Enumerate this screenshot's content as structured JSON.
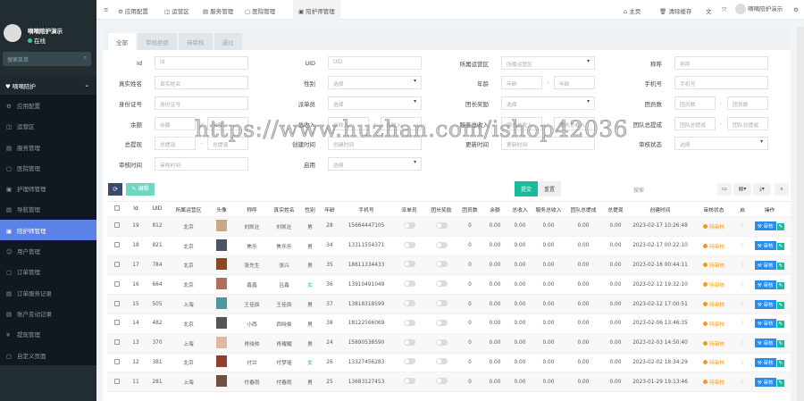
{
  "sidebar": {
    "user_name": "嘀嘀陪护演示",
    "status": "在线",
    "search_placeholder": "搜索菜单",
    "group": "嘀嘀陪护",
    "items": [
      {
        "label": "应用配置",
        "icon": "gear-icon",
        "glyph": "⚙"
      },
      {
        "label": "运营区",
        "icon": "map-icon",
        "glyph": "◫"
      },
      {
        "label": "服务管理",
        "icon": "list-icon",
        "glyph": "▤"
      },
      {
        "label": "医院管理",
        "icon": "hospital-icon",
        "glyph": "▢"
      },
      {
        "label": "护理师管理",
        "icon": "card-icon",
        "glyph": "▣"
      },
      {
        "label": "导航管理",
        "icon": "nav-icon",
        "glyph": "▤"
      },
      {
        "label": "陪护师管理",
        "icon": "id-card-icon",
        "glyph": "▣",
        "active": true
      },
      {
        "label": "用户管理",
        "icon": "user-icon",
        "glyph": "☺"
      },
      {
        "label": "订单管理",
        "icon": "order-icon",
        "glyph": "▢"
      },
      {
        "label": "订单服务记录",
        "icon": "record-icon",
        "glyph": "▤"
      },
      {
        "label": "账户变动记录",
        "icon": "account-icon",
        "glyph": "▤"
      },
      {
        "label": "提现管理",
        "icon": "yen-icon",
        "glyph": "¥"
      },
      {
        "label": "自定义页面",
        "icon": "page-icon",
        "glyph": "▢"
      }
    ]
  },
  "topbar": {
    "nav": [
      {
        "label": "应用配置",
        "glyph": "⚙"
      },
      {
        "label": "运营区",
        "glyph": "◫"
      },
      {
        "label": "服务管理",
        "glyph": "▤"
      },
      {
        "label": "医院管理",
        "glyph": "▢"
      },
      {
        "label": "陪护师管理",
        "glyph": "▣",
        "active": true
      }
    ],
    "home": "主页",
    "clear_cache": "清除缓存",
    "user": "嘀嘀陪护演示"
  },
  "tabs": [
    "全部",
    "审核拒绝",
    "待审核",
    "通过"
  ],
  "form": {
    "rows": [
      [
        {
          "label": "Id",
          "type": "text",
          "ph": "Id"
        },
        {
          "label": "UID",
          "type": "text",
          "ph": "UID"
        },
        {
          "label": "所属运营区",
          "type": "select",
          "ph": "所属运营区"
        },
        {
          "label": "称呼",
          "type": "text",
          "ph": "称呼"
        }
      ],
      [
        {
          "label": "真实姓名",
          "type": "text",
          "ph": "真实姓名"
        },
        {
          "label": "性别",
          "type": "select",
          "ph": "选择"
        },
        {
          "label": "年龄",
          "type": "range",
          "ph": "年龄"
        },
        {
          "label": "手机号",
          "type": "text",
          "ph": "手机号"
        }
      ],
      [
        {
          "label": "身份证号",
          "type": "text",
          "ph": "身份证号"
        },
        {
          "label": "派单员",
          "type": "select",
          "ph": "选择"
        },
        {
          "label": "团长奖励",
          "type": "select",
          "ph": "选择"
        },
        {
          "label": "团员数",
          "type": "range",
          "ph": "团员数"
        }
      ],
      [
        {
          "label": "余额",
          "type": "range",
          "ph": "余额"
        },
        {
          "label": "总收入",
          "type": "range",
          "ph": "总收入"
        },
        {
          "label": "服务总收入",
          "type": "range",
          "ph": "服务总收入"
        },
        {
          "label": "团队总提成",
          "type": "range",
          "ph": "团队总提成"
        }
      ],
      [
        {
          "label": "总提现",
          "type": "range",
          "ph": "总提现"
        },
        {
          "label": "创建时间",
          "type": "text",
          "ph": "创建时间"
        },
        {
          "label": "更新时间",
          "type": "text",
          "ph": "更新时间"
        },
        {
          "label": "审核状态",
          "type": "select",
          "ph": "选择"
        }
      ],
      [
        {
          "label": "审核时间",
          "type": "text",
          "ph": "审核时间"
        },
        {
          "label": "启用",
          "type": "select",
          "ph": "选择"
        }
      ]
    ],
    "submit": "提交",
    "reset": "重置"
  },
  "toolbar": {
    "edit": "编辑",
    "search_placeholder": "搜索"
  },
  "table": {
    "columns": [
      "Id",
      "UID",
      "所属运营区",
      "头像",
      "称呼",
      "真实姓名",
      "性别",
      "年龄",
      "手机号",
      "派单员",
      "团长奖励",
      "团员数",
      "余额",
      "总收入",
      "服务总收入",
      "团队总提成",
      "总提现",
      "创建时间",
      "审核状态",
      "启",
      "操作"
    ],
    "audit_label": "审核",
    "rows": [
      {
        "id": "19",
        "uid": "812",
        "area": "北京",
        "nick": "刘凯壮",
        "name": "刘凯壮",
        "gender": "男",
        "age": "28",
        "phone": "15664447105",
        "members": "0",
        "balance": "0.00",
        "income": "0.00",
        "svc": "0.00",
        "team": "0.00",
        "withdraw": "0.00",
        "created": "2023-02-17 10:26:48",
        "status": "待审核",
        "avatar_color": "#c9a88a"
      },
      {
        "id": "18",
        "uid": "821",
        "area": "北京",
        "nick": "焦乐",
        "name": "焦乐乐",
        "gender": "男",
        "age": "34",
        "phone": "13311554371",
        "members": "0",
        "balance": "0.00",
        "income": "0.00",
        "svc": "0.00",
        "team": "0.00",
        "withdraw": "0.00",
        "created": "2023-02-17 00:22:10",
        "status": "待审核",
        "avatar_color": "#4a5568"
      },
      {
        "id": "17",
        "uid": "784",
        "area": "北京",
        "nick": "张先生",
        "name": "张兴",
        "gender": "男",
        "age": "35",
        "phone": "18611334433",
        "members": "0",
        "balance": "0.00",
        "income": "0.00",
        "svc": "0.00",
        "team": "0.00",
        "withdraw": "0.00",
        "created": "2023-02-16 00:44:11",
        "status": "待审核",
        "avatar_color": "#8a4a20"
      },
      {
        "id": "16",
        "uid": "664",
        "area": "北京",
        "nick": "鑫鑫",
        "name": "吕鑫",
        "gender": "女",
        "age": "36",
        "phone": "13910491049",
        "members": "0",
        "balance": "0.00",
        "income": "0.00",
        "svc": "0.00",
        "team": "0.00",
        "withdraw": "0.00",
        "created": "2023-02-12 19:32:10",
        "status": "待审核",
        "avatar_color": "#b07060"
      },
      {
        "id": "15",
        "uid": "505",
        "area": "上海",
        "nick": "王佳辰",
        "name": "王佳辰",
        "gender": "男",
        "age": "37",
        "phone": "13818318599",
        "members": "0",
        "balance": "0.00",
        "income": "0.00",
        "svc": "0.00",
        "team": "0.00",
        "withdraw": "0.00",
        "created": "2023-02-12 17:00:51",
        "status": "待审核",
        "avatar_color": "#4a9aa0"
      },
      {
        "id": "14",
        "uid": "482",
        "area": "北京",
        "nick": "小西",
        "name": "西晓俊",
        "gender": "男",
        "age": "38",
        "phone": "18122566069",
        "members": "0",
        "balance": "0.00",
        "income": "0.00",
        "svc": "0.00",
        "team": "0.00",
        "withdraw": "0.00",
        "created": "2023-02-06 13:46:35",
        "status": "待审核",
        "avatar_color": "#555"
      },
      {
        "id": "13",
        "uid": "370",
        "area": "上海",
        "nick": "肖晓帅",
        "name": "肖耀耀",
        "gender": "男",
        "age": "24",
        "phone": "15890538590",
        "members": "0",
        "balance": "0.00",
        "income": "0.00",
        "svc": "0.00",
        "team": "0.00",
        "withdraw": "0.00",
        "created": "2023-02-03 14:50:40",
        "status": "待审核",
        "avatar_color": "#e0b8a0"
      },
      {
        "id": "12",
        "uid": "381",
        "area": "北京",
        "nick": "付兰",
        "name": "付梦瑶",
        "gender": "女",
        "age": "26",
        "phone": "13327456283",
        "members": "0",
        "balance": "0.00",
        "income": "0.00",
        "svc": "0.00",
        "team": "0.00",
        "withdraw": "0.00",
        "created": "2023-02-02 18:34:29",
        "status": "待审核",
        "avatar_color": "#904030"
      },
      {
        "id": "11",
        "uid": "281",
        "area": "上海",
        "nick": "付春雨",
        "name": "付春雨",
        "gender": "男",
        "age": "25",
        "phone": "13683127453",
        "members": "0",
        "balance": "0.00",
        "income": "0.00",
        "svc": "0.00",
        "team": "0.00",
        "withdraw": "0.00",
        "created": "2023-01-29 19:13:46",
        "status": "待审核",
        "avatar_color": "#705040"
      }
    ]
  },
  "watermark": "https://www.huzhan.com/ishop42036"
}
